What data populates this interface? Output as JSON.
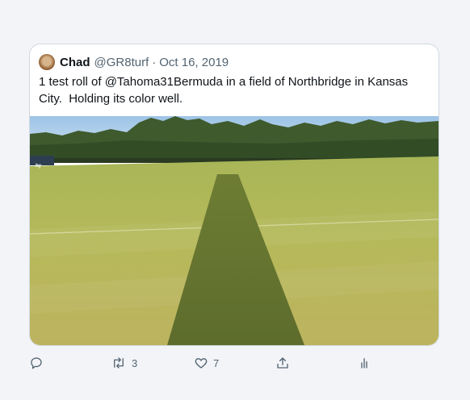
{
  "tweet": {
    "display_name": "Chad",
    "handle": "@GR8turf",
    "separator": "·",
    "date": "Oct 16, 2019",
    "text": "1 test roll of @Tahoma31Bermuda in a field of Northbridge in Kansas\nCity.  Holding its color well.",
    "media": {
      "sign_text": "hy"
    }
  },
  "actions": {
    "reply": {
      "icon": "reply-icon",
      "count": ""
    },
    "retweet": {
      "icon": "retweet-icon",
      "count": "3"
    },
    "like": {
      "icon": "heart-icon",
      "count": "7"
    },
    "share": {
      "icon": "share-icon"
    },
    "analytics": {
      "icon": "analytics-icon"
    }
  },
  "colors": {
    "text_primary": "#0f1419",
    "text_secondary": "#536471",
    "card_border": "#cfd9de"
  }
}
